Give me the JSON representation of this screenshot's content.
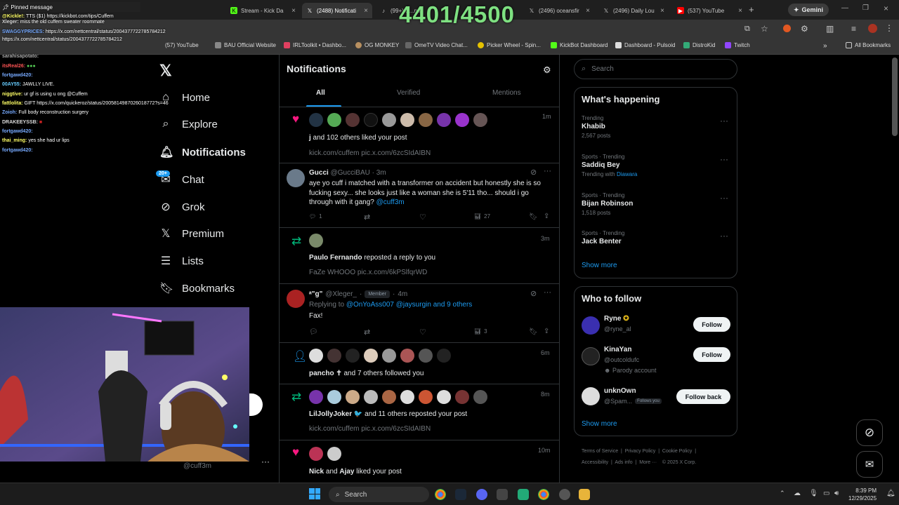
{
  "counter": "4401/4500",
  "tabs": [
    {
      "label": "Stream - Kick Da"
    },
    {
      "label": "(2488) Notificati"
    },
    {
      "label": "(99+) Ji...na"
    },
    {
      "label": "(2496) oceansfir"
    },
    {
      "label": "(2496) Daily Lou"
    },
    {
      "label": "(537) YouTube"
    }
  ],
  "profile_label": "Gemini",
  "bookmarks": [
    "(57) YouTube",
    "BAU Official Website",
    "IRLToolkit • Dashbo...",
    "OG MONKEY",
    "OmeTV Video Chat...",
    "Picker Wheel - Spin...",
    "KickBot Dashboard",
    "Dashboard - Pulsoid",
    "DistroKid",
    "Twitch",
    "All Bookmarks"
  ],
  "nav": {
    "home": "Home",
    "explore": "Explore",
    "notifications": "Notifications",
    "chat": "Chat",
    "chat_badge": "20+",
    "grok": "Grok",
    "premium": "Premium",
    "lists": "Lists",
    "bookmarks": "Bookmarks",
    "handle": "@cuff3m"
  },
  "header": {
    "title": "Notifications",
    "tabs": [
      "All",
      "Verified",
      "Mentions"
    ]
  },
  "notifications": [
    {
      "time": "1m",
      "text_bold": "j",
      "text": " and 102 others liked your post",
      "sub": "kick.com/cuffem pic.x.com/6zcSIdAIBN"
    },
    {
      "name": "Gucci",
      "handle": "@GucciBAU",
      "time": "3m",
      "body": "aye yo cuff i matched with a transformer on accident but honestly she is so fucking sexy... she looks just like a woman she is 5'11 tho... should i go through with it gang?",
      "mention": "@cuff3m",
      "replies": "1",
      "views": "27"
    },
    {
      "time": "3m",
      "text_bold": "Paulo Fernando",
      "text": " reposted a reply to you",
      "sub": "FaZe WHOOO pic.x.com/6kPSlfqrWD"
    },
    {
      "name": "ᵃ\"g\"",
      "handle": "@Xleger_",
      "badge": "Member",
      "time": "4m",
      "reply_to": "Replying to",
      "reply_users": "@OnYoAss007 @jaysurgin and 9 others",
      "body": "Fax!",
      "views": "3"
    },
    {
      "time": "6m",
      "text_bold": "pancho ✝",
      "text": " and 7 others followed you"
    },
    {
      "time": "8m",
      "text_bold": "LilJollyJoker 🐦",
      "text": " and 11 others reposted your post",
      "sub": "kick.com/cuffem pic.x.com/6zcSIdAIBN"
    },
    {
      "time": "10m",
      "text_bold": "Nick",
      "text_mid": " and ",
      "text_bold2": "Ajay",
      "text": " liked your post"
    }
  ],
  "search": {
    "placeholder": "Search"
  },
  "happening": {
    "title": "What's happening",
    "trends": [
      {
        "context": "Trending",
        "name": "Khabib",
        "posts": "2,567 posts"
      },
      {
        "context": "Sports · Trending",
        "name": "Saddiq Bey",
        "posts": "Trending with",
        "with": "Diawara"
      },
      {
        "context": "Sports · Trending",
        "name": "Bijan Robinson",
        "posts": "1,518 posts"
      },
      {
        "context": "Sports · Trending",
        "name": "Jack Benter",
        "posts": ""
      }
    ],
    "show_more": "Show more"
  },
  "follow": {
    "title": "Who to follow",
    "users": [
      {
        "name": "Ryne",
        "handle": "@ryne_al",
        "button": "Follow"
      },
      {
        "name": "KinaYan",
        "handle": "@outcoldufc",
        "note": "Parody account",
        "button": "Follow"
      },
      {
        "name": "unknOwn",
        "handle": "@Spam...",
        "tag": "Follows you",
        "button": "Follow back"
      }
    ],
    "show_more": "Show more"
  },
  "footer": {
    "links": [
      "Terms of Service",
      "Privacy Policy",
      "Cookie Policy",
      "Accessibility",
      "Ads info",
      "More ···",
      "© 2025 X Corp."
    ]
  },
  "chat": [
    {
      "user": "Pinned message",
      "msg": ""
    },
    {
      "user": "@Kickle!:",
      "msg": "TTS ($1) https://kickbot.com/tips/Cuffem"
    },
    {
      "user": "Xleger:",
      "msg": "miss the old cuffem sweater roommate"
    },
    {
      "user": "SWAGGYPRICES:",
      "msg": "https://x.com/nettcentral/status/2004377722785784212"
    },
    {
      "user": "",
      "msg": "https://x.com/nettcentral/status/2004377722785784212"
    },
    {
      "user": "sarahisapotato:",
      "msg": ""
    },
    {
      "user": "itsReal26:",
      "msg": ""
    },
    {
      "user": "fortgawd420:",
      "msg": ""
    },
    {
      "user": "00AY55:",
      "msg": "JAWLLY LIVE."
    },
    {
      "user": "niggtive:",
      "msg": "ur gf is using u ong @Cuffem"
    },
    {
      "user": "fattlolita:",
      "msg": "GIFT  https://x.com/quickeroz/status/2005814987026018772?s=46"
    },
    {
      "user": "Zoioh:",
      "msg": "Full body reconstruction surgery"
    },
    {
      "user": "DRAKEEYSSB:",
      "msg": ""
    },
    {
      "user": "fortgawd420:",
      "msg": ""
    },
    {
      "user": "thai_ming:",
      "msg": "yes she had ur lips"
    },
    {
      "user": "fortgawd420:",
      "msg": ""
    }
  ],
  "taskbar": {
    "search": "Search",
    "time": "8:39 PM",
    "date": "12/29/2025"
  },
  "colors": {
    "accent": "#1d9bf0",
    "like": "#f91880",
    "repost": "#00ba7c",
    "counter": "#7ee081"
  }
}
